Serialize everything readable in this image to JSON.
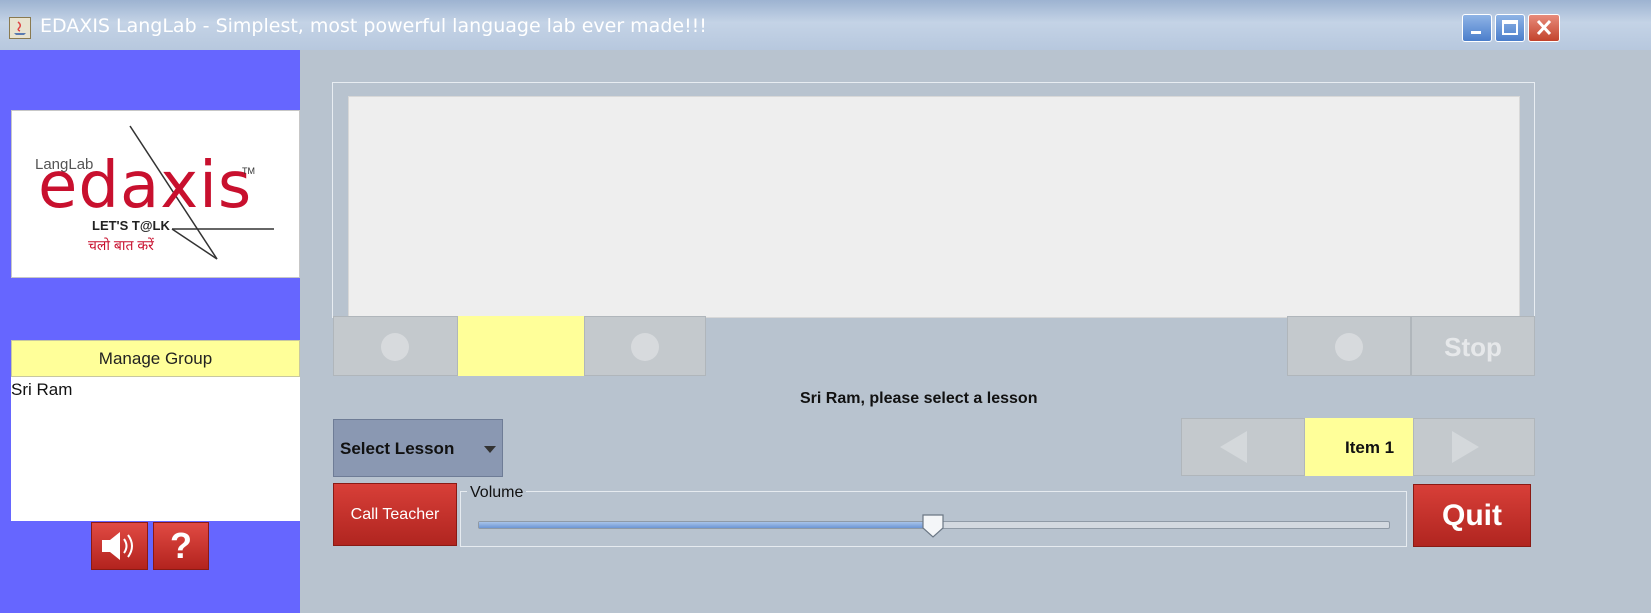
{
  "window": {
    "title": "EDAXIS LangLab - Simplest, most powerful language lab ever made!!!",
    "controls": [
      "minimize-icon",
      "maximize-icon",
      "close-icon"
    ]
  },
  "sidebar": {
    "logo": {
      "small_text": "LangLab",
      "main_text": "edaxis",
      "trademark": "TM",
      "tagline": "LET'S T@LK",
      "hindi_tagline": "चलो बात करें"
    },
    "manage_group_label": "Manage Group",
    "users": [
      "Sri Ram"
    ],
    "speaker_icon": "speaker-icon",
    "help_label": "?"
  },
  "main": {
    "stop_label": "Stop",
    "status_message": "Sri Ram, please select a lesson",
    "lesson_select": {
      "label": "Select Lesson"
    },
    "item_label": "Item 1",
    "call_teacher_label": "Call Teacher",
    "volume": {
      "legend": "Volume",
      "level": 0.5
    },
    "quit_label": "Quit"
  },
  "colors": {
    "accent_red": "#c8102e",
    "highlight_yellow": "#ffff99",
    "sidebar_blue": "#6666ff"
  }
}
